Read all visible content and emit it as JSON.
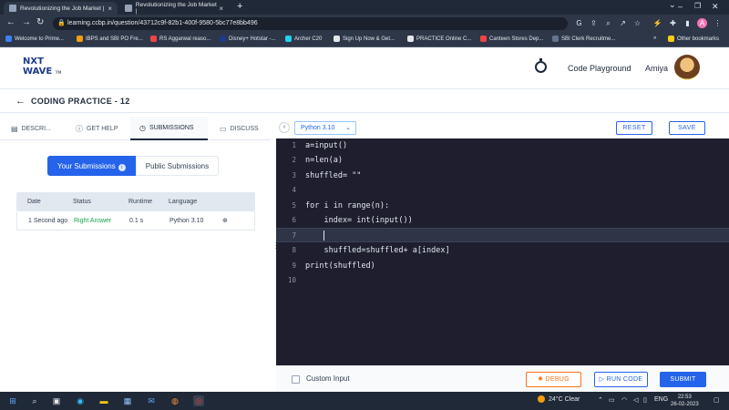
{
  "browser": {
    "tabs": [
      {
        "label": "Revolutionizing the Job Market |"
      },
      {
        "label": "Revolutionizing the Job Market |"
      }
    ],
    "new_tab": "+",
    "url": "learning.ccbp.in/question/43712c9f-82b1-400f-9580-5bc77e8bb496",
    "bookmarks": [
      {
        "label": "Welcome to Prime...",
        "color": "#3b82f6"
      },
      {
        "label": "IBPS and SBI PO Fre...",
        "color": "#f59e0b"
      },
      {
        "label": "RS Aggarwal reaso...",
        "color": "#ef4444"
      },
      {
        "label": "Disney+ Hotstar -...",
        "color": "#1e3a8a"
      },
      {
        "label": "Archer C20",
        "color": "#22d3ee"
      },
      {
        "label": "Sign Up Now & Get...",
        "color": "#e5e7eb"
      },
      {
        "label": "PRACTICE Online C...",
        "color": "#e5e7eb"
      },
      {
        "label": "Canteen Stores Dep...",
        "color": "#ef4444"
      },
      {
        "label": "SBI Clerk Recruitme...",
        "color": "#64748b"
      }
    ],
    "bookmarks_overflow": "»",
    "other_bookmarks": "Other bookmarks"
  },
  "header": {
    "logo_line1": "NXT",
    "logo_line2": "WAVE",
    "logo_tm": "TM",
    "code_playground": "Code Playground",
    "username": "Amiya"
  },
  "practice": {
    "title": "CODING PRACTICE - 12"
  },
  "left_tabs": [
    {
      "label": "DESCRI...",
      "icon": "description-icon"
    },
    {
      "label": "GET HELP",
      "icon": "help-icon"
    },
    {
      "label": "SUBMISSIONS",
      "icon": "clock-icon"
    },
    {
      "label": "DISCUSS",
      "icon": "chat-icon"
    }
  ],
  "submissions_toggle": {
    "yours": "Your Submissions",
    "public": "Public Submissions"
  },
  "submissions_table": {
    "headers": [
      "Date",
      "Status",
      "Runtime",
      "Language"
    ],
    "rows": [
      {
        "date": "1 Second ago",
        "status": "Right Answer",
        "runtime": "0.1 s",
        "language": "Python 3.10"
      }
    ]
  },
  "editor": {
    "language": "Python 3.10",
    "reset": "RESET",
    "save": "SAVE",
    "lines": [
      {
        "n": "1",
        "code": "a=input()"
      },
      {
        "n": "2",
        "code": "n=len(a)"
      },
      {
        "n": "3",
        "code": "shuffled= \"\""
      },
      {
        "n": "4",
        "code": ""
      },
      {
        "n": "5",
        "code": "for i in range(n):"
      },
      {
        "n": "6",
        "code": "    index= int(input())"
      },
      {
        "n": "7",
        "code": "    "
      },
      {
        "n": "8",
        "code": "    shuffled=shuffled+ a[index]"
      },
      {
        "n": "9",
        "code": "print(shuffled)"
      },
      {
        "n": "10",
        "code": ""
      }
    ],
    "custom_input": "Custom Input",
    "debug": "DEBUG",
    "run": "RUN CODE",
    "submit": "SUBMIT"
  },
  "taskbar": {
    "weather": "24°C  Clear",
    "lang": "ENG",
    "time": "22:53",
    "date": "26-02-2023"
  },
  "colors": {
    "accent": "#2563eb",
    "success": "#16a34a",
    "debug": "#f97316",
    "editor_bg": "#1e1e2e"
  }
}
